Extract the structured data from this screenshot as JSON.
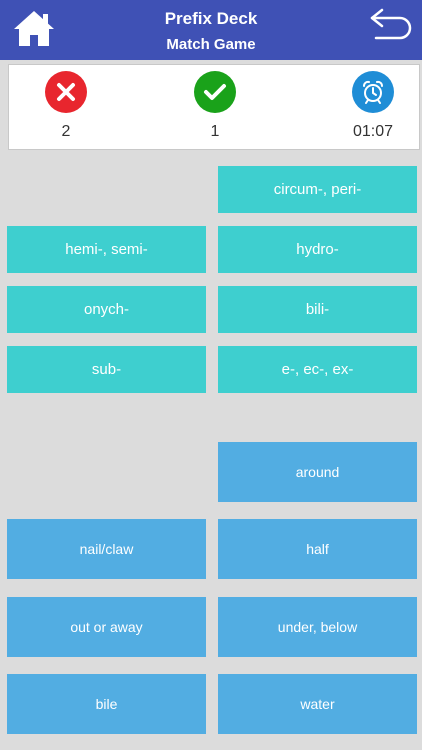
{
  "header": {
    "title": "Prefix Deck",
    "subtitle": "Match Game"
  },
  "stats": {
    "wrong": "2",
    "correct": "1",
    "timer": "01:07"
  },
  "colors": {
    "header": "#3f51b5",
    "term_card": "#3ecfcf",
    "definition_card": "#52ade2",
    "wrong_icon": "#e8262e",
    "correct_icon": "#1aa21a",
    "timer_icon": "#1f8dd6"
  },
  "icons": {
    "home": "home-icon",
    "back": "back-arrow-icon",
    "wrong": "x-circle-icon",
    "correct": "check-circle-icon",
    "timer": "alarm-clock-icon"
  },
  "terms": [
    "circum-, peri-",
    "hemi-, semi-",
    "hydro-",
    "onych-",
    "bili-",
    "sub-",
    "e-, ec-, ex-"
  ],
  "definitions": [
    "around",
    "nail/claw",
    "half",
    "out or away",
    "under, below",
    "bile",
    "water"
  ]
}
